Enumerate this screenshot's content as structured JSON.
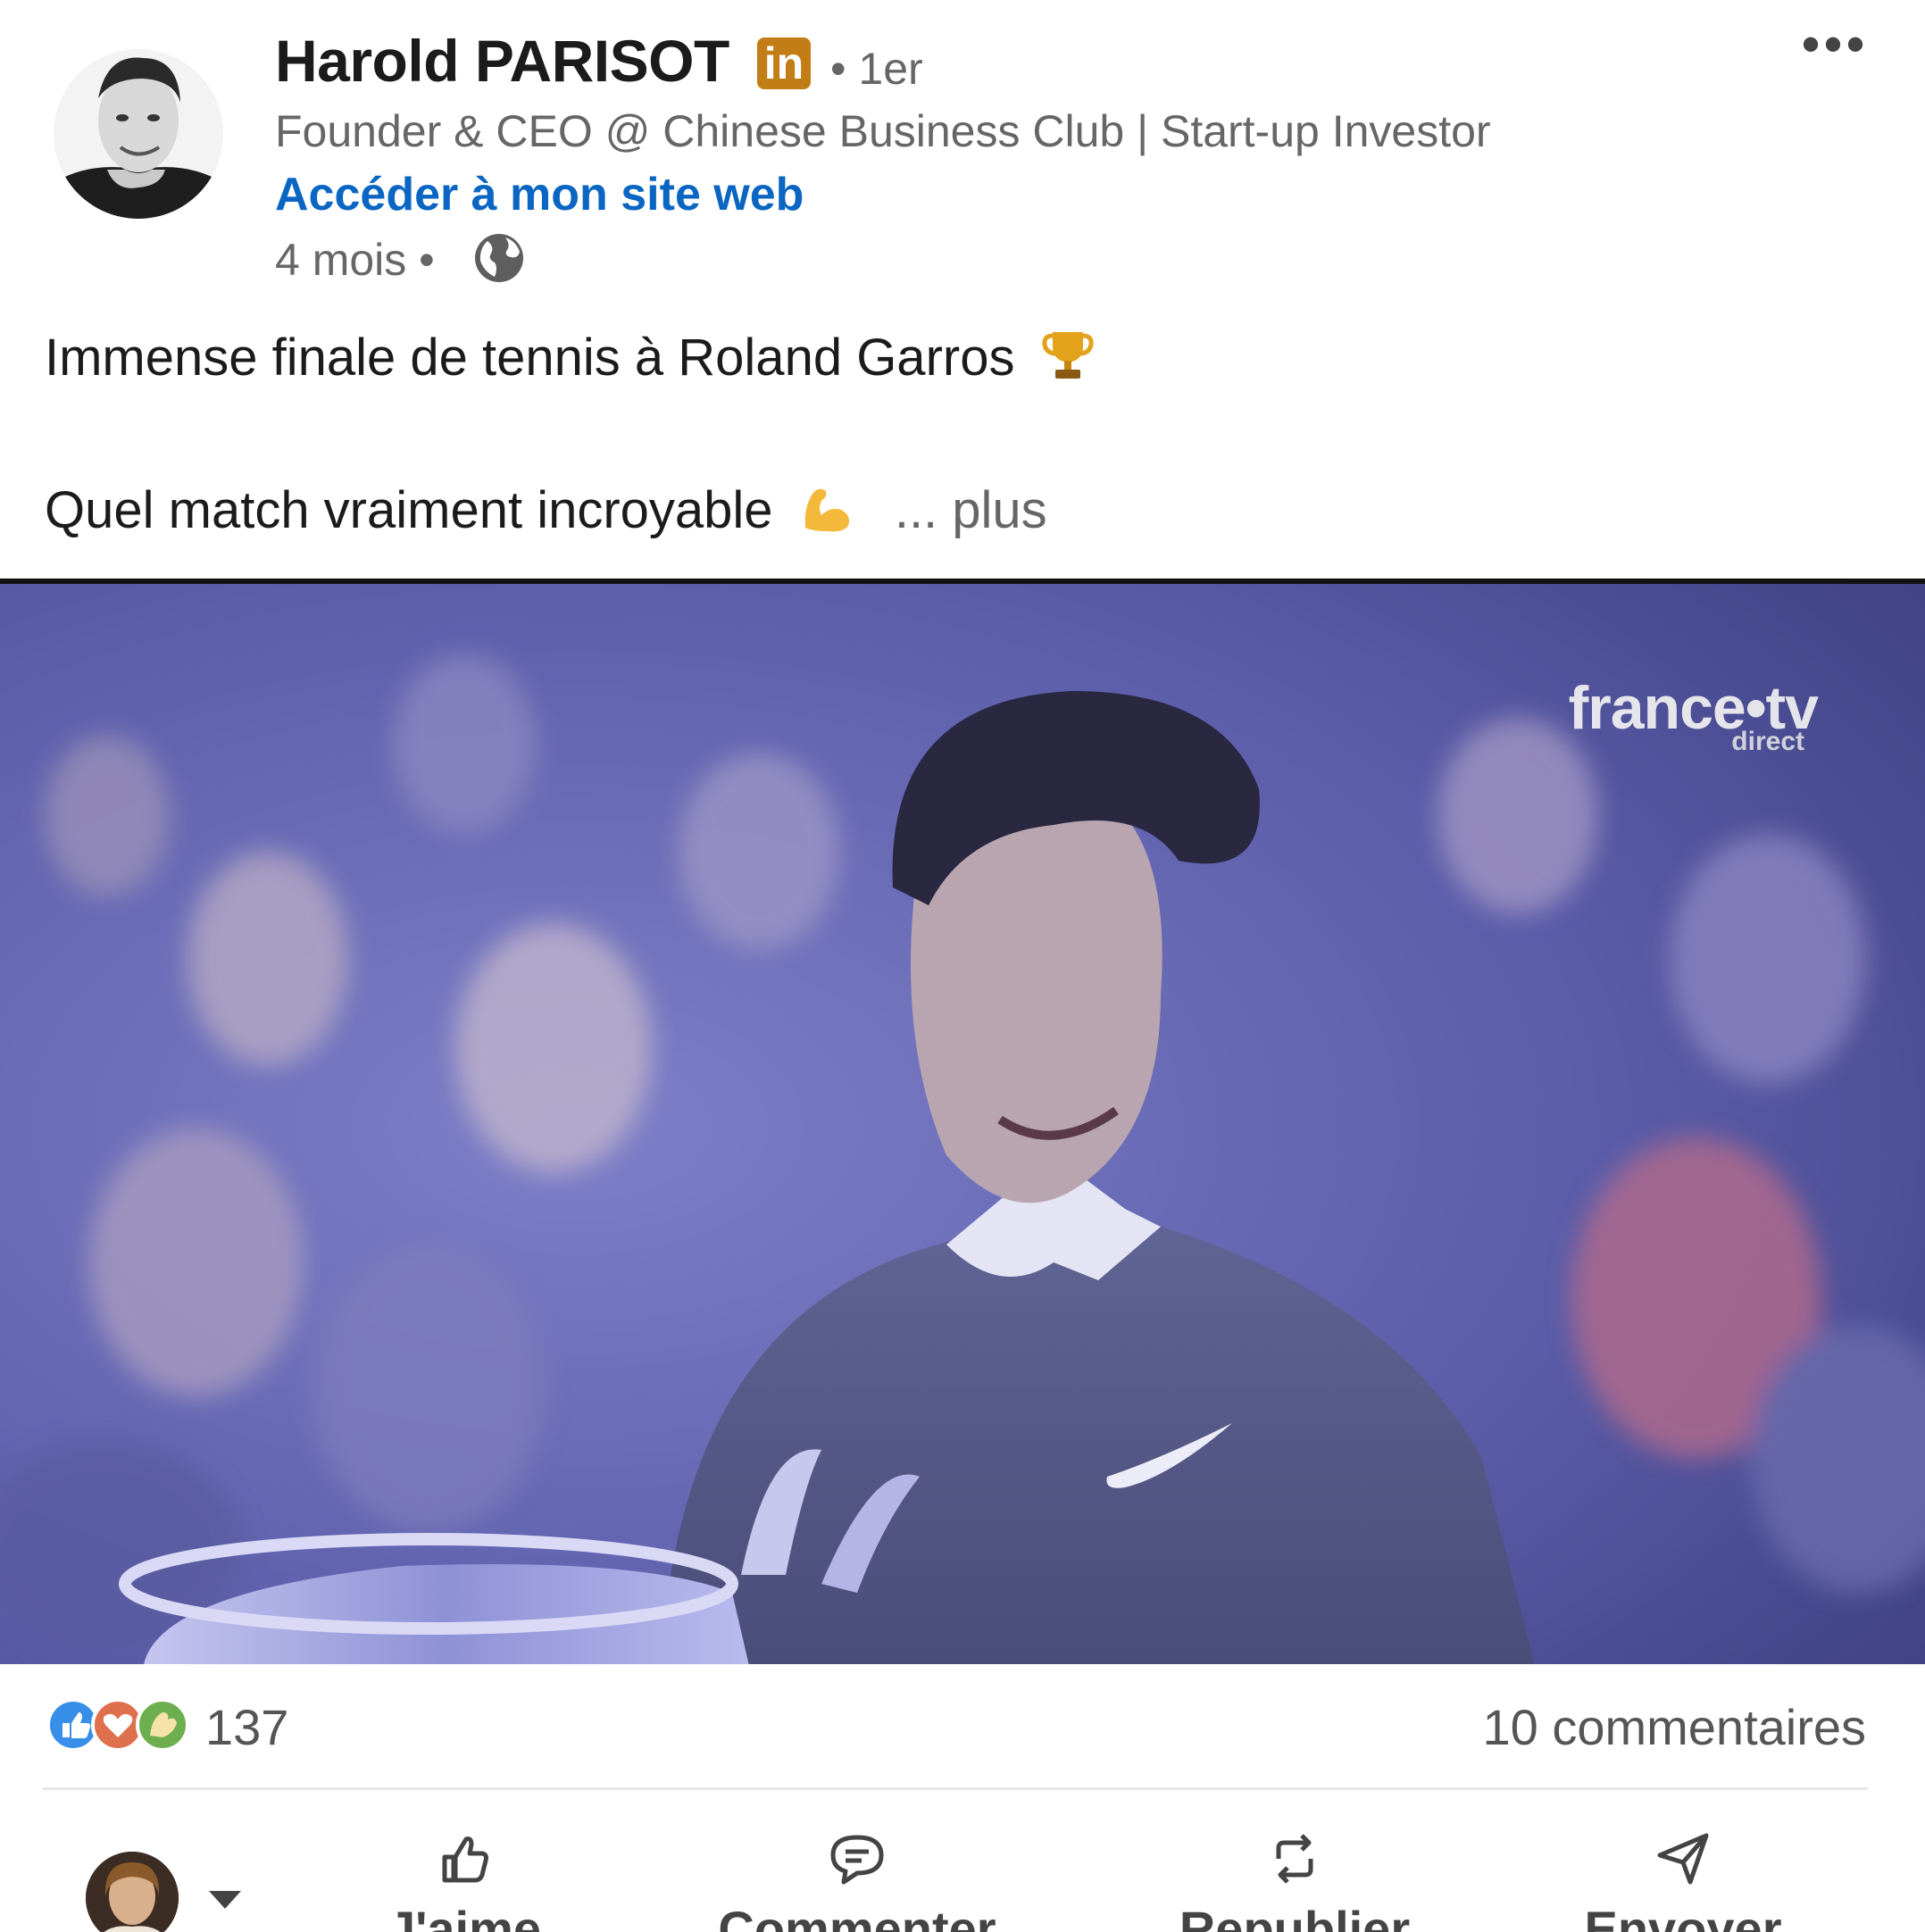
{
  "author": {
    "name": "Harold PARISOT",
    "badge": "in",
    "degree": "• 1er",
    "headline": "Founder & CEO @ Chinese Business Club | Start-up Investor",
    "website_link": "Accéder à mon site web",
    "time": "4 mois •",
    "visibility_icon": "globe-icon"
  },
  "more_icon": "•••",
  "post": {
    "line1": "Immense finale de tennis à Roland Garros",
    "line1_emoji": "trophy",
    "line2": "Quel match vraiment incroyable",
    "line2_emoji": "flexed-biceps",
    "see_more": "... plus"
  },
  "media": {
    "broadcaster": "france•tv",
    "broadcaster_sub": "direct"
  },
  "social": {
    "reaction_icons": [
      "like-reaction-icon",
      "love-reaction-icon",
      "celebrate-reaction-icon"
    ],
    "reaction_count": "137",
    "comments": "10 commentaires"
  },
  "actions": {
    "like": "J'aime",
    "comment": "Commenter",
    "repost": "Republier",
    "send": "Envoyer"
  },
  "colors": {
    "link": "#0a66c2",
    "badge": "#c37d16",
    "muted_text": "#666666",
    "like_blue": "#378fe9",
    "love_red": "#df704d",
    "celebrate_green": "#6dae4f"
  }
}
